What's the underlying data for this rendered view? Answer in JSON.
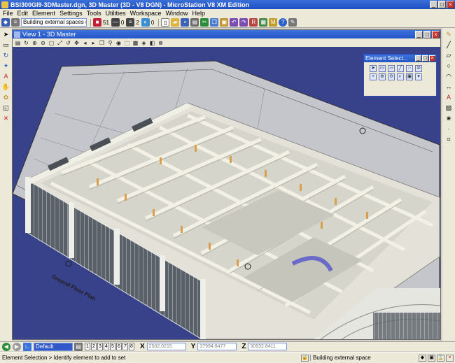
{
  "window": {
    "title": "BSI300GI9-3DMaster.dgn, 3D Master (3D - V8 DGN) - MicroStation V8 XM Edition",
    "minimize": "_",
    "maximize": "□",
    "close": "×"
  },
  "menu": [
    "File",
    "Edit",
    "Element",
    "Settings",
    "Tools",
    "Utilities",
    "Workspace",
    "Window",
    "Help"
  ],
  "toolbar": {
    "level_value": "Building external spaces (A-FIG-Bldg",
    "color_value": "51",
    "style_value": "0",
    "weight_value": "2",
    "transparency_value": "0"
  },
  "view": {
    "title": "View 1 - 3D Master",
    "drawing_labels": [
      "Ground Floor Plan"
    ]
  },
  "element_selection": {
    "title": "Element Select..."
  },
  "bottom": {
    "level_combo": "Default",
    "view_numbers": [
      "1",
      "2",
      "3",
      "4",
      "5",
      "6",
      "7",
      "8"
    ],
    "x_label": "X",
    "x_value": "2502.0215",
    "y_label": "Y",
    "y_value": "37994.8477",
    "z_label": "Z",
    "z_value": "30932.8411"
  },
  "status": {
    "prompt": "Element Selection > Identify element to add to set",
    "message": "Building external space"
  },
  "colors": {
    "title_blue": "#1d4fc2",
    "canvas_bg": "#38428a",
    "chrome": "#ece9d8"
  }
}
